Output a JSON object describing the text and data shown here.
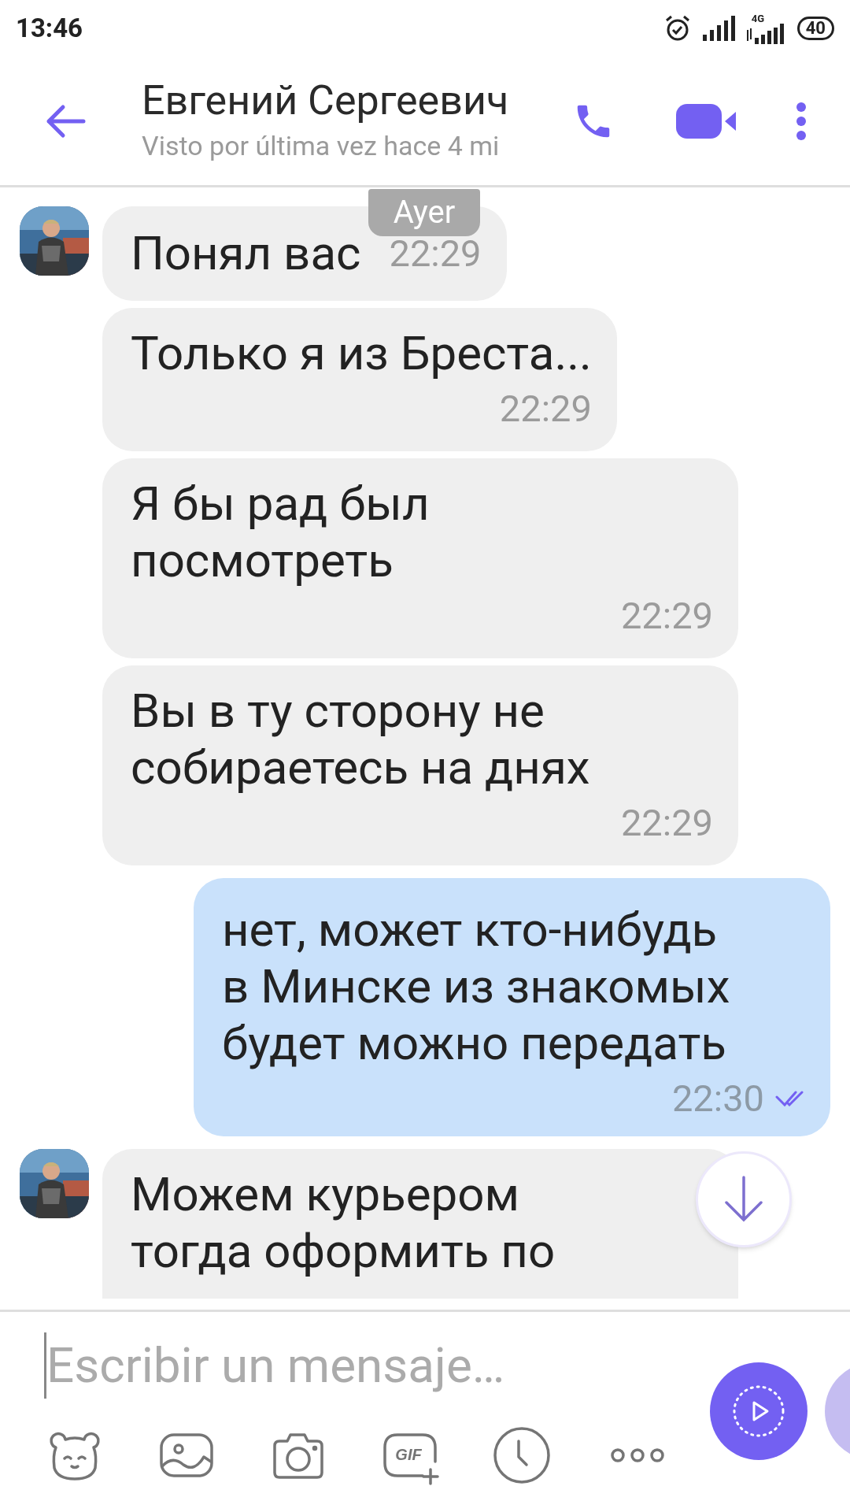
{
  "status_bar": {
    "time": "13:46",
    "network": "4G",
    "battery": "40"
  },
  "header": {
    "name": "Евгений Сергеевич",
    "subtitle": "Visto por última vez hace 4 mi"
  },
  "date_pill": "Ayer",
  "messages": [
    {
      "kind": "incoming",
      "show_avatar": true,
      "compact": true,
      "text": "Понял вас",
      "time": "22:29"
    },
    {
      "kind": "incoming",
      "show_avatar": false,
      "compact": false,
      "text": "Только я из Бреста...",
      "time": "22:29"
    },
    {
      "kind": "incoming",
      "show_avatar": false,
      "compact": false,
      "text": "Я бы рад был\nпосмотреть",
      "time": "22:29"
    },
    {
      "kind": "incoming",
      "show_avatar": false,
      "compact": false,
      "text": "Вы в ту сторону не\nсобираетесь на днях",
      "time": "22:29"
    },
    {
      "kind": "outgoing",
      "read": true,
      "text": "нет, может кто-нибудь\nв Минске из знакомых\nбудет можно передать",
      "time": "22:30"
    },
    {
      "kind": "incoming",
      "show_avatar": true,
      "compact": false,
      "text": "Можем курьером\nтогда оформить по"
    }
  ],
  "composer": {
    "placeholder": "Escribir un mensaje…"
  },
  "tools": [
    {
      "kind": "sticker"
    },
    {
      "kind": "gallery"
    },
    {
      "kind": "camera"
    },
    {
      "kind": "gif",
      "label": "GIF"
    },
    {
      "kind": "schedule"
    },
    {
      "kind": "more"
    }
  ]
}
